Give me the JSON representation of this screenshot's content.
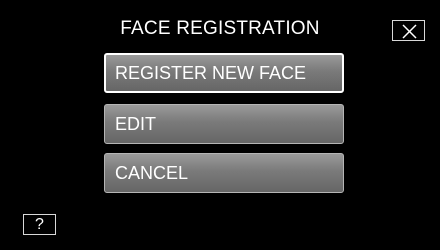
{
  "screen": {
    "title": "FACE REGISTRATION"
  },
  "menu": {
    "items": [
      {
        "label": "REGISTER NEW FACE",
        "highlighted": true
      },
      {
        "label": "EDIT",
        "highlighted": false
      },
      {
        "label": "CANCEL",
        "highlighted": false
      }
    ]
  },
  "controls": {
    "close_icon": "close-icon",
    "help_label": "?"
  },
  "colors": {
    "background": "#000000",
    "button": "#7a7a7a",
    "text": "#ffffff"
  }
}
